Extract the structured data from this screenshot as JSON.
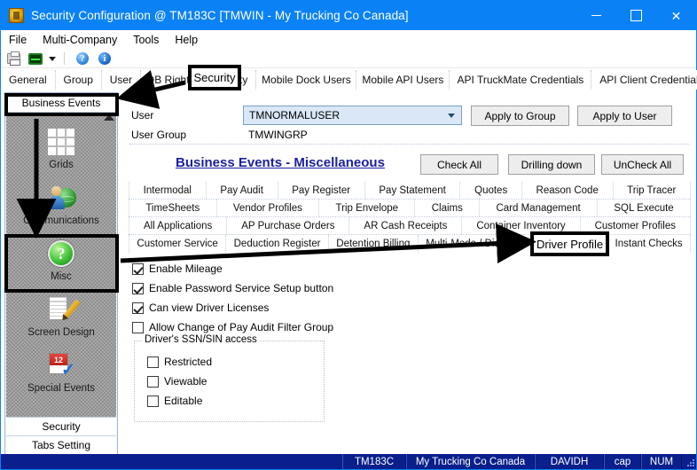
{
  "window": {
    "title": "Security Configuration @ TM183C [TMWIN - My Trucking Co Canada]",
    "icon": "shield-badge-icon",
    "minimize": "–",
    "maximize": "□",
    "close": "✕"
  },
  "menu": {
    "items": [
      "File",
      "Multi-Company",
      "Tools",
      "Help"
    ]
  },
  "toolbar": {
    "items": [
      {
        "name": "print-icon",
        "glyph": ""
      },
      {
        "name": "monitor-icon",
        "glyph": ""
      },
      {
        "name": "dropdown-caret-icon",
        "glyph": ""
      },
      {
        "name": "help-icon",
        "glyph": "?"
      },
      {
        "name": "info-icon",
        "glyph": "i"
      }
    ]
  },
  "main_tabs": {
    "items": [
      {
        "label": "General",
        "selected": false
      },
      {
        "label": "Group",
        "selected": false
      },
      {
        "label": "User",
        "selected": false
      },
      {
        "label": "DB Rights",
        "selected": false
      },
      {
        "label": "Security",
        "selected": true
      },
      {
        "label": "Mobile Dock Users",
        "selected": false
      },
      {
        "label": "Mobile API Users",
        "selected": false
      },
      {
        "label": "API TruckMate Credentials",
        "selected": false
      },
      {
        "label": "API Client Credentials",
        "selected": false
      }
    ]
  },
  "sidebar": {
    "header": "Business Events",
    "items": [
      {
        "label": "Grids",
        "icon": "grids-icon"
      },
      {
        "label": "Communications",
        "icon": "communications-icon"
      },
      {
        "label": "Misc",
        "icon": "misc-question-icon"
      },
      {
        "label": "Screen Design",
        "icon": "screen-design-icon"
      },
      {
        "label": "Special Events",
        "icon": "special-events-calendar-icon"
      }
    ],
    "footer": [
      "Security",
      "Tabs Setting"
    ],
    "special_events_day": "12"
  },
  "user_section": {
    "user_label": "User",
    "user_value": "TMNORMALUSER",
    "user_group_label": "User Group",
    "user_group_value": "TMWINGRP",
    "apply_to_group": "Apply to Group",
    "apply_to_user": "Apply to User"
  },
  "section": {
    "title": "Business Events - Miscellaneous",
    "check_all": "Check All",
    "drilling_down": "Drilling down",
    "uncheck_all": "UnCheck All"
  },
  "sub_tabs": {
    "row1": [
      "Intermodal",
      "Pay Audit",
      "Pay Register",
      "Pay Statement",
      "Quotes",
      "Reason Code",
      "Trip Tracer"
    ],
    "row2": [
      "TimeSheets",
      "Vendor Profiles",
      "Trip Envelope",
      "Claims",
      "Card Management",
      "SQL Execute"
    ],
    "row3": [
      "All Applications",
      "AP Purchase Orders",
      "AR Cash Receipts",
      "Container Inventory",
      "Customer Profiles"
    ],
    "row4": [
      "Customer Service",
      "Deduction Register",
      "Detention Billing",
      "Multi-Mode / Dispatch",
      "Driver Profile",
      "Instant Checks"
    ]
  },
  "options": {
    "items": [
      {
        "label": "Enable Mileage",
        "checked": true
      },
      {
        "label": "Enable Password Service Setup button",
        "checked": true
      },
      {
        "label": "Can view Driver Licenses",
        "checked": true
      },
      {
        "label": "Allow Change of Pay Audit Filter Group",
        "checked": false
      }
    ]
  },
  "ssn_group": {
    "legend": "Driver's SSN/SIN access",
    "items": [
      {
        "label": "Restricted",
        "checked": false
      },
      {
        "label": "Viewable",
        "checked": false
      },
      {
        "label": "Editable",
        "checked": false
      }
    ]
  },
  "statusbar": {
    "cells": [
      "TM183C",
      "My Trucking Co Canada",
      "DAVIDH",
      "cap",
      "NUM"
    ]
  },
  "annotations": {
    "security_callout": "Security",
    "driver_profile_callout": "Driver Profile",
    "highlight_color": "#000000"
  },
  "colors": {
    "titlebar": "#0a82f5",
    "statusbar": "#0a1f8c",
    "section_title": "#1b1f9e",
    "combo_bg": "#d9e7f7",
    "sidebar_bg": "#8f8f8f"
  }
}
